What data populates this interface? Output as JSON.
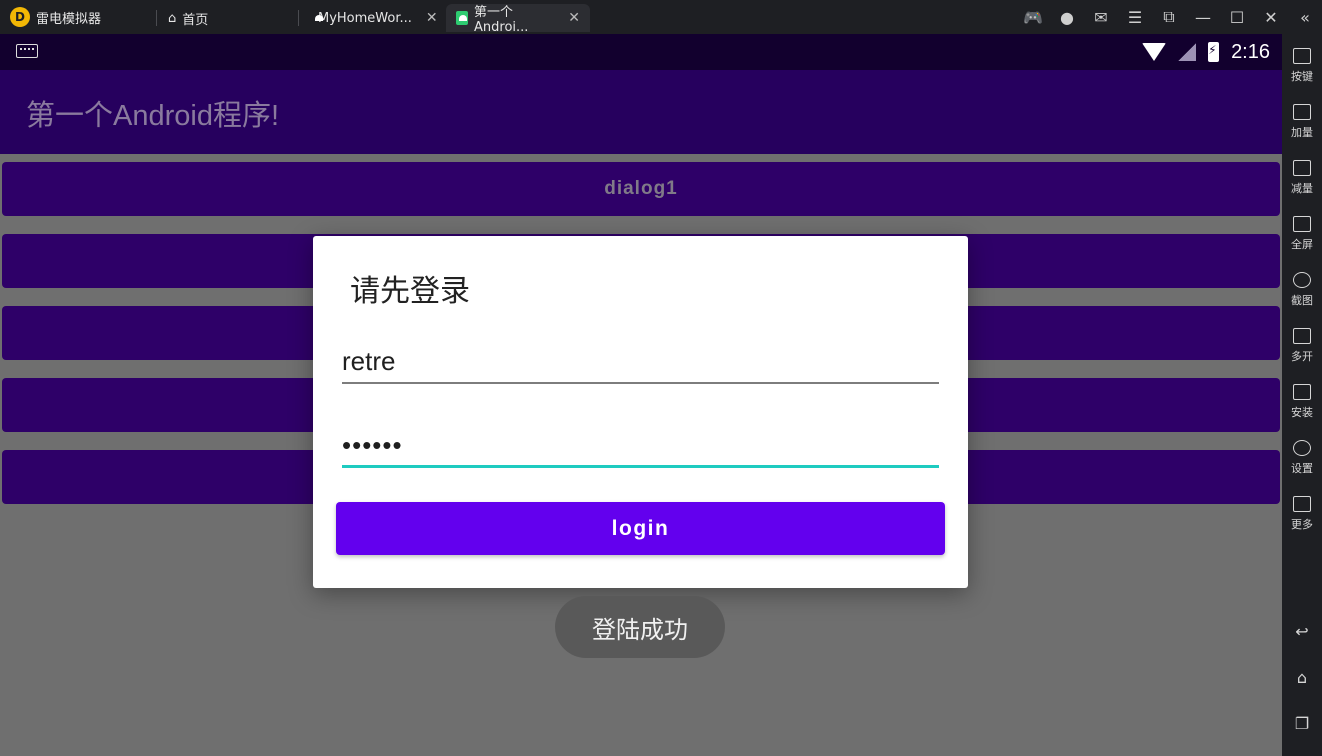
{
  "titlebar": {
    "app_name": "雷电模拟器",
    "tabs": [
      {
        "label": "首页"
      },
      {
        "label": "MyHomeWor..."
      },
      {
        "label": "第一个Androi..."
      }
    ],
    "close_glyph": "✕"
  },
  "statusbar": {
    "time": "2:16"
  },
  "appbar": {
    "title": "第一个Android程序!"
  },
  "buttons": [
    {
      "label": "dialog1"
    },
    {
      "label": ""
    },
    {
      "label": ""
    },
    {
      "label": ""
    },
    {
      "label": ""
    }
  ],
  "dialog": {
    "title": "请先登录",
    "username_value": "retre",
    "password_value": "••••••",
    "login_label": "login"
  },
  "toast": {
    "text": "登陆成功"
  },
  "sidebar": {
    "items": [
      {
        "label": "按键",
        "icon": "keyboard-icon"
      },
      {
        "label": "加量",
        "icon": "volume-up-icon"
      },
      {
        "label": "减量",
        "icon": "volume-down-icon"
      },
      {
        "label": "全屏",
        "icon": "fullscreen-icon"
      },
      {
        "label": "截图",
        "icon": "scissors-icon"
      },
      {
        "label": "多开",
        "icon": "multi-instance-icon"
      },
      {
        "label": "安装",
        "icon": "apk-install-icon"
      },
      {
        "label": "设置",
        "icon": "settings-icon"
      },
      {
        "label": "更多",
        "icon": "more-icon"
      }
    ]
  },
  "colors": {
    "appbar": "#26005e",
    "button": "#2e0068",
    "accent": "#6300ee",
    "focus_line": "#1ecbc0"
  }
}
